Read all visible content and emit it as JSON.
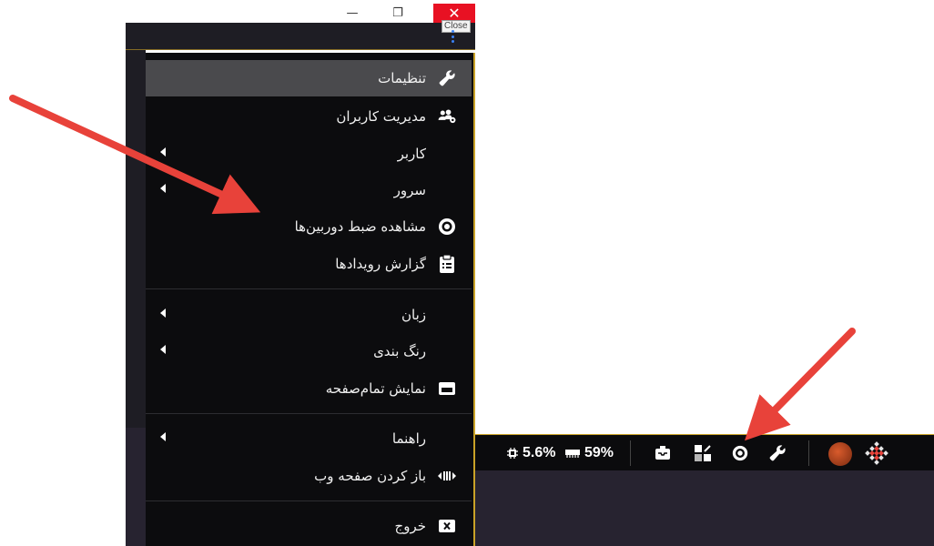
{
  "window": {
    "minimize_glyph": "—",
    "maximize_glyph": "❐",
    "close_glyph": "✕",
    "close_tooltip": "Close"
  },
  "menu": {
    "items": [
      {
        "id": "settings",
        "label": "تنظیمات",
        "icon": "wrench-icon",
        "active": true,
        "submenu": false
      },
      {
        "id": "user-management",
        "label": "مدیریت کاربران",
        "icon": "users-cog-icon",
        "active": false,
        "submenu": false
      },
      {
        "id": "user",
        "label": "کاربر",
        "icon": "",
        "active": false,
        "submenu": true
      },
      {
        "id": "server",
        "label": "سرور",
        "icon": "",
        "active": false,
        "submenu": true
      },
      {
        "id": "camera-recordings",
        "label": "مشاهده ضبط دوربین‌ها",
        "icon": "record-eye-icon",
        "active": false,
        "submenu": false
      },
      {
        "id": "event-report",
        "label": "گزارش رویدادها",
        "icon": "clipboard-list-icon",
        "active": false,
        "submenu": false
      },
      {
        "id": "language",
        "label": "زبان",
        "icon": "",
        "active": false,
        "submenu": true
      },
      {
        "id": "color-theme",
        "label": "رنگ بندی",
        "icon": "",
        "active": false,
        "submenu": true
      },
      {
        "id": "fullscreen",
        "label": "نمایش تمام‌صفحه",
        "icon": "window-icon",
        "active": false,
        "submenu": false
      },
      {
        "id": "help",
        "label": "راهنما",
        "icon": "",
        "active": false,
        "submenu": true
      },
      {
        "id": "open-web",
        "label": "باز کردن صفحه وب",
        "icon": "web-route-icon",
        "active": false,
        "submenu": false
      },
      {
        "id": "exit",
        "label": "خروج",
        "icon": "close-box-icon",
        "active": false,
        "submenu": false
      }
    ]
  },
  "statusbar": {
    "cpu_value": "5.6%",
    "ram_value": "59%"
  },
  "colors": {
    "accent": "#c9a227",
    "arrow": "#e8423a",
    "menu_bg": "#0c0c0e",
    "active_bg": "#4a4a4d",
    "close_red": "#e81123"
  }
}
